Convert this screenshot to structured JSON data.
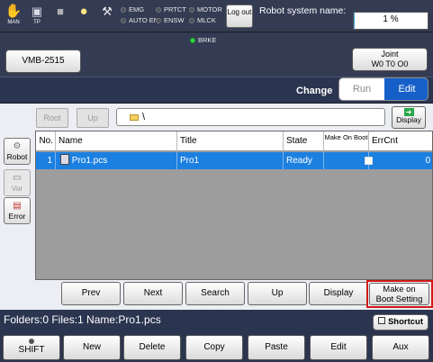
{
  "topbar": {
    "icons": [
      {
        "name": "hand-icon",
        "label": "MAN"
      },
      {
        "name": "teach-pendant-icon",
        "label": "TP"
      },
      {
        "name": "stop-icon",
        "label": ""
      },
      {
        "name": "lightbulb-icon",
        "label": ""
      },
      {
        "name": "tools-warning-icon",
        "label": ""
      }
    ],
    "indicators": {
      "emg": "EMG",
      "auto_en": "AUTO EN",
      "prtct": "PRTCT",
      "ensw": "ENSW",
      "motor": "MOTOR",
      "mlck": "MLCK",
      "brke": "BRKE"
    },
    "logout_label": "Log out",
    "robot_name_label": "Robot system name:",
    "progress_percent": 1,
    "progress_text": "1 %"
  },
  "header": {
    "vmb_label": "VMB-2515",
    "joint_line1": "Joint",
    "joint_line2": "W0 T0 O0",
    "change_label": "Change",
    "run_label": "Run",
    "edit_label": "Edit"
  },
  "side": {
    "robot_label": "Robot",
    "var_label": "Var",
    "error_label": "Error"
  },
  "pathbar": {
    "root_label": "Root",
    "up_label": "Up",
    "path": "\\",
    "display_label": "Display"
  },
  "table": {
    "columns": [
      "No.",
      "Name",
      "Title",
      "State",
      "Make On Boot",
      "ErrCnt"
    ],
    "rows": [
      {
        "no": "1",
        "name": "Pro1.pcs",
        "title": "Pro1",
        "state": "Ready",
        "make_on_boot": true,
        "errcnt": "0"
      }
    ]
  },
  "toolbar": {
    "prev": "Prev",
    "next": "Next",
    "search": "Search",
    "up": "Up",
    "display": "Display",
    "boot_line1": "Make on",
    "boot_line2": "Boot Setting"
  },
  "status": {
    "text": "Folders:0  Files:1  Name:Pro1.pcs",
    "shortcut_label": "Shortcut"
  },
  "functions": {
    "shift": "SHIFT",
    "new": "New",
    "delete": "Delete",
    "copy": "Copy",
    "paste": "Paste",
    "edit": "Edit",
    "aux": "Aux"
  },
  "colors": {
    "accent": "#1560c8",
    "selection": "#1c80e0",
    "highlight_box": "#d01818",
    "status_green": "#2ee040"
  }
}
